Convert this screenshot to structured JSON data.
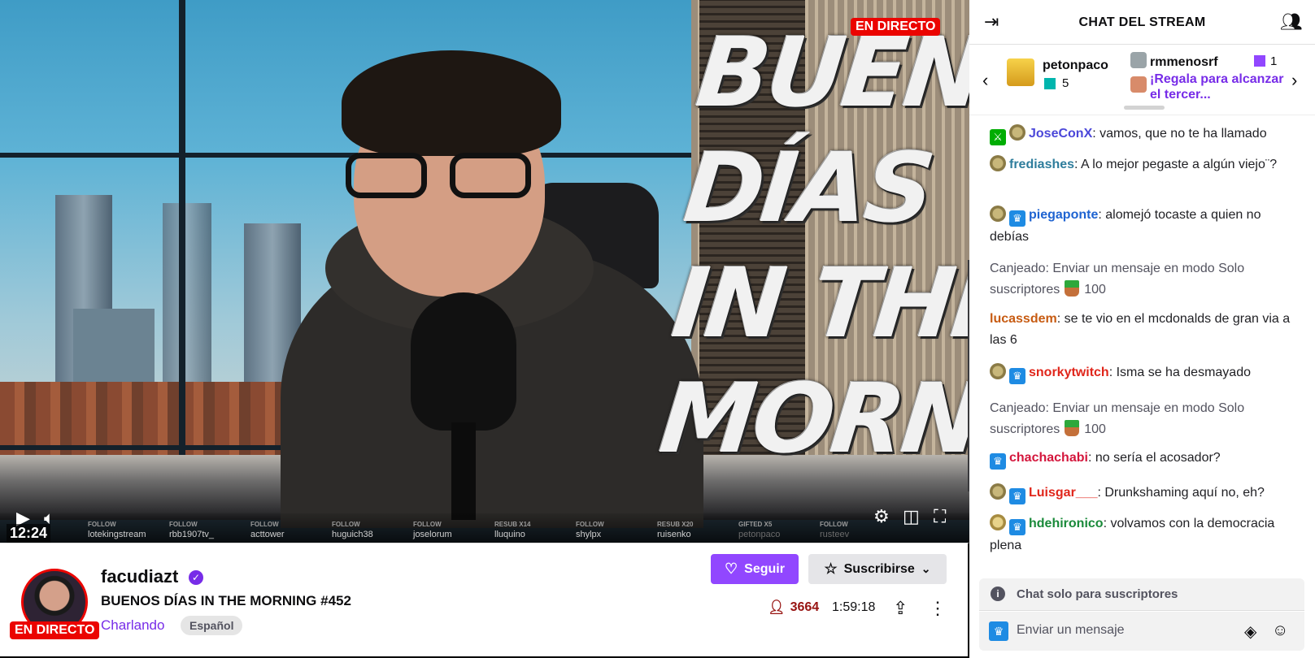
{
  "video": {
    "live_badge": "EN DIRECTO",
    "overlay_lines": [
      "BUENOS",
      "DÍAS",
      "IN THE",
      "MORNING"
    ],
    "time": "12:24",
    "events": [
      {
        "kind": "FOLLOW",
        "user": "lotekingstream"
      },
      {
        "kind": "FOLLOW",
        "user": "rbb1907tv_"
      },
      {
        "kind": "FOLLOW",
        "user": "acttower"
      },
      {
        "kind": "FOLLOW",
        "user": "huguich38"
      },
      {
        "kind": "FOLLOW",
        "user": "joselorum"
      },
      {
        "kind": "RESUB X14",
        "user": "lluquino"
      },
      {
        "kind": "FOLLOW",
        "user": "shylpx"
      },
      {
        "kind": "RESUB X20",
        "user": "ruisenko"
      },
      {
        "kind": "GIFTED X5",
        "user": "petonpaco"
      },
      {
        "kind": "FOLLOW",
        "user": "rusteev"
      }
    ]
  },
  "info": {
    "live_badge": "EN DIRECTO",
    "channel": "facudiazt",
    "title": "BUENOS DÍAS IN THE MORNING #452",
    "category": "Charlando",
    "tag": "Español",
    "follow_label": "Seguir",
    "subscribe_label": "Suscribirse",
    "viewers": "3664",
    "uptime": "1:59:18"
  },
  "chat": {
    "title": "CHAT DEL STREAM",
    "leaderboard": {
      "first": {
        "name": "petonpaco",
        "count": "5"
      },
      "second": {
        "name": "rmmenosrf",
        "count": "1"
      },
      "promo": "¡Regala para alcanzar el tercer..."
    },
    "messages": [
      {
        "user": "JoseConX",
        "color": "#4b47d9",
        "text": ": vamos, que no te ha llamado"
      },
      {
        "user": "frediashes",
        "color": "#2e7d9c",
        "text": ": A lo mejor pegaste a algún viejo¨?"
      },
      {
        "user": "piegaponte",
        "color": "#1e63d1",
        "text": ": alomejó tocaste a quien no debías"
      },
      {
        "redeem": "Canjeado: Enviar un mensaje en modo Solo suscriptores",
        "cost": "100"
      },
      {
        "user": "lucassdem",
        "color": "#c75b12",
        "text": ": se te vio en el mcdonalds de gran via a las 6"
      },
      {
        "user": "snorkytwitch",
        "color": "#e0261b",
        "text": ": Isma se ha desmayado"
      },
      {
        "redeem": "Canjeado: Enviar un mensaje en modo Solo suscriptores",
        "cost": "100"
      },
      {
        "user": "chachachabi",
        "color": "#d4163c",
        "text": ": no sería el acosador?"
      },
      {
        "user": "Luisgar___",
        "color": "#e0261b",
        "text": ": Drunkshaming aquí no, eh?"
      },
      {
        "user": "hdehironico",
        "color": "#1a8a3a",
        "text": ": volvamos con la democracia plena"
      }
    ],
    "subs_only": "Chat solo para suscriptores",
    "input_placeholder": "Enviar un mensaje"
  }
}
